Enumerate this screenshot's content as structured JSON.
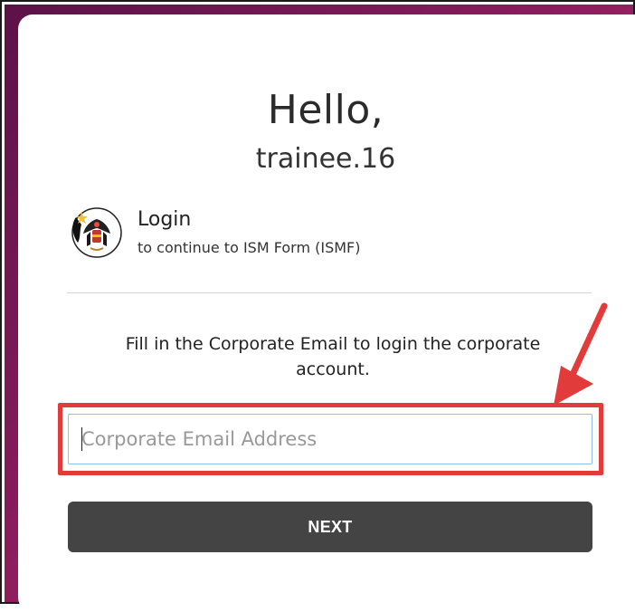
{
  "greeting": {
    "hello": "Hello,",
    "username": "trainee.16"
  },
  "login": {
    "title": "Login",
    "subtitle": "to continue to ISM Form (ISMF)"
  },
  "instruction": "Fill in the Corporate Email to login the corporate account.",
  "email_input": {
    "placeholder": "Corporate Email Address",
    "value": ""
  },
  "next_button": {
    "label": "NEXT"
  },
  "colors": {
    "background_gradient_start": "#5c1247",
    "background_gradient_end": "#d63d6a",
    "highlight": "#e23b3b",
    "button": "#444444",
    "input_border": "#8cc3ee"
  },
  "icons": {
    "logo": "state-crest-logo-icon",
    "annotation": "red-arrow-icon"
  }
}
